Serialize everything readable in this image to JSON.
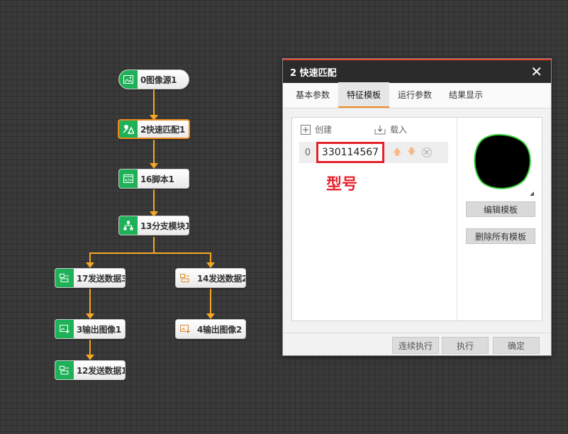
{
  "flow": {
    "nodes": [
      {
        "id": "n0",
        "label": "0图像源1",
        "icon": "image-source-icon"
      },
      {
        "id": "n2",
        "label": "2快速匹配1",
        "icon": "fast-match-icon"
      },
      {
        "id": "n16",
        "label": "16脚本1",
        "icon": "script-icon"
      },
      {
        "id": "n13",
        "label": "13分支模块1",
        "icon": "branch-icon"
      },
      {
        "id": "n17",
        "label": "17发送数据3",
        "icon": "send-data-icon"
      },
      {
        "id": "n14",
        "label": "14发送数据2",
        "icon": "send-data-icon"
      },
      {
        "id": "n3",
        "label": "3输出图像1",
        "icon": "output-image-icon"
      },
      {
        "id": "n4",
        "label": "4输出图像2",
        "icon": "output-image-icon"
      },
      {
        "id": "n12",
        "label": "12发送数据1",
        "icon": "send-data-icon"
      }
    ],
    "colors": {
      "connector": "#f5a623",
      "node_icon_bg": "#1fb157",
      "selected_border": "#f08a1d"
    }
  },
  "dialog": {
    "title": "2 快速匹配",
    "close_icon": "close-icon",
    "tabs": [
      "基本参数",
      "特征模板",
      "运行参数",
      "结果显示"
    ],
    "active_tab": "特征模板",
    "toolbar": {
      "create_label": "创建",
      "load_label": "载入"
    },
    "template_rows": [
      {
        "index": "0",
        "name": "330114567"
      }
    ],
    "annotation": "型号",
    "edit_template_label": "编辑模板",
    "delete_all_label": "删除所有模板",
    "footer": {
      "continuous_label": "连续执行",
      "execute_label": "执行",
      "confirm_label": "确定"
    },
    "colors": {
      "title_accent": "#e0442b",
      "highlight_box": "#e3232b",
      "template_outline": "#39d13a"
    }
  }
}
